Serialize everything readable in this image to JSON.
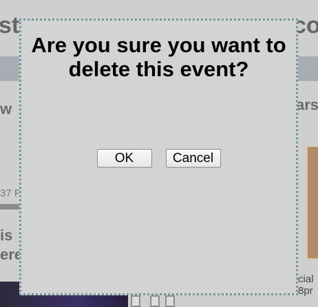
{
  "background": {
    "title_left": "st",
    "title_right": "co",
    "text_w": "w",
    "text_ars": "ars",
    "text_time": "37 P",
    "text_is": "is",
    "text_ere": "ere",
    "text_cial": "cial",
    "text_8pm": "8pr"
  },
  "dialog": {
    "message": "Are you sure you want to delete this event?",
    "ok_label": "OK",
    "cancel_label": "Cancel"
  }
}
